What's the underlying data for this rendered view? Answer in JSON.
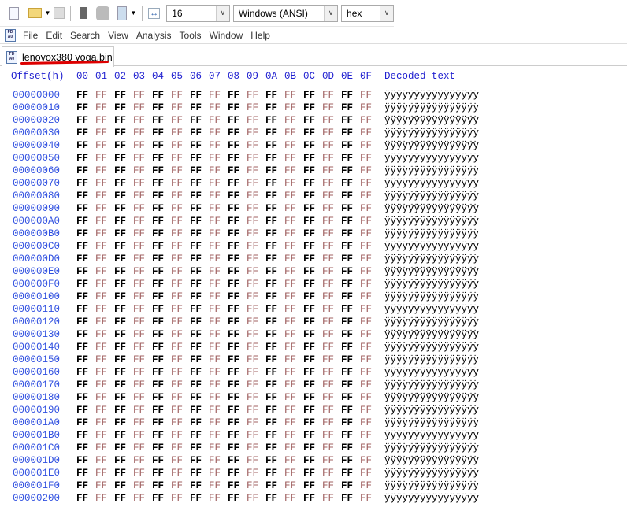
{
  "toolbar": {
    "bytes_per_row": "16",
    "encoding": "Windows (ANSI)",
    "offset_base": "hex",
    "icons": [
      "new-file-icon",
      "open-file-icon",
      "save-icon",
      "ram-icon",
      "disk-icon",
      "image-icon",
      "bytes-per-row-icon"
    ]
  },
  "menu": [
    "File",
    "Edit",
    "Search",
    "View",
    "Analysis",
    "Tools",
    "Window",
    "Help"
  ],
  "tab": {
    "label": "lenovox380 yoga.bin",
    "highlight_color": "#dd0000"
  },
  "header": {
    "offset": "Offset(h)",
    "columns": [
      "00",
      "01",
      "02",
      "03",
      "04",
      "05",
      "06",
      "07",
      "08",
      "09",
      "0A",
      "0B",
      "0C",
      "0D",
      "0E",
      "0F"
    ],
    "decoded": "Decoded text"
  },
  "byte_value": "FF",
  "decoded_row": "ÿÿÿÿÿÿÿÿÿÿÿÿÿÿÿÿ",
  "offsets": [
    "00000000",
    "00000010",
    "00000020",
    "00000030",
    "00000040",
    "00000050",
    "00000060",
    "00000070",
    "00000080",
    "00000090",
    "000000A0",
    "000000B0",
    "000000C0",
    "000000D0",
    "000000E0",
    "000000F0",
    "00000100",
    "00000110",
    "00000120",
    "00000130",
    "00000140",
    "00000150",
    "00000160",
    "00000170",
    "00000180",
    "00000190",
    "000001A0",
    "000001B0",
    "000001C0",
    "000001D0",
    "000001E0",
    "000001F0",
    "00000200"
  ]
}
